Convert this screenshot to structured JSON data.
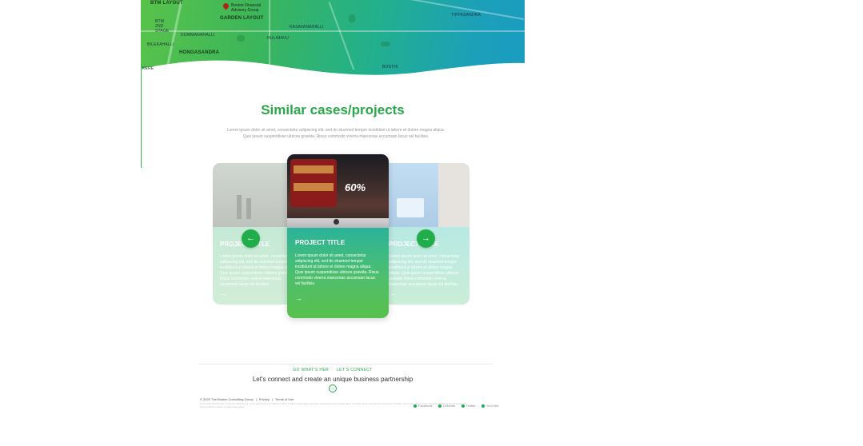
{
  "map": {
    "labels": [
      "BTM LAYOUT",
      "GARDEN LAYOUT",
      "BTM 2ND STAGE",
      "BILEKAHALLI",
      "HONGASANDRA",
      "DOMMANAHALLI",
      "HULIMAVU",
      "KASAVANAHALLI",
      "TIPPASANDRA",
      "BOSTHI",
      "KERE"
    ],
    "pin_label": "Boston Financial Advisory Group"
  },
  "section": {
    "title": "Similar cases/projects",
    "subtitle": "Lorem ipsum dolor sit amet, consectetur adipiscing elit, sed do eiusmod tempor incididunt ut labore et dolore magna aliqua. Quis ipsum suspendisse ultrices gravida. Risus commodo viverra maecenas accumsan lacus vel facilisis."
  },
  "cards": {
    "left": {
      "title": "PROJECT TITLE",
      "text": "Lorem ipsum dolor sit amet, consectetur adipiscing elit, sed do eiusmod tempor incididunt ut labore et dolore magna aliqua. Quis ipsum suspendisse ultrices gravida. Risus commodo viverra maecenas accumsan lacus vel facilisis.",
      "arrow": "→"
    },
    "center": {
      "title": "PROJECT TITLE",
      "text": "Lorem ipsum dolor sit amet, consectetur adipiscing elit, sed do eiusmod tempor incididunt ut labore et dolore magna aliqua. Quis ipsum suspendisse ultrices gravida. Risus commodo viverra maecenas accumsan lacus vel facilisis.",
      "arrow": "→",
      "promo": "60%"
    },
    "right": {
      "title": "PROJECT TITLE",
      "text": "Lorem ipsum dolor sit amet, consectetur adipiscing elit, sed do eiusmod tempor incididunt ut labore et dolore magna aliqua. Quis ipsum suspendisse ultrices gravida. Risus commodo viverra maecenas accumsan lacus vel facilisis.",
      "arrow": "→"
    }
  },
  "carousel": {
    "prev": "←",
    "next": "→"
  },
  "footer": {
    "link1": "GO WHAT'S HER",
    "link2": "LET'S CONNECT",
    "tagline": "Let's connect and create an unique business partnership",
    "cta": "→",
    "copyright": "© 2020 The Boston Consulting Group",
    "privacy": "Privacy",
    "terms": "Terms of Use",
    "social": [
      "Facebook",
      "LinkedIn",
      "Twitter",
      "YouTube"
    ],
    "fine_print": "Lorem ipsum dolor sit amet, consectetur adipiscing elit, sed do eiusmod tempor incididunt ut labore et dolore magna aliqua. Quis ipsum suspendisse ultrices gravida. Risus commodo viverra maecenas accumsan lacus vel facilisis. Lorem ipsum dolor sit amet, consectetur adipiscing elit, sed do eiusmod tempor incididunt ut labore et dolore magna aliqua."
  },
  "colors": {
    "brand_green": "#2aa84a",
    "button_green": "#1fae4a"
  }
}
